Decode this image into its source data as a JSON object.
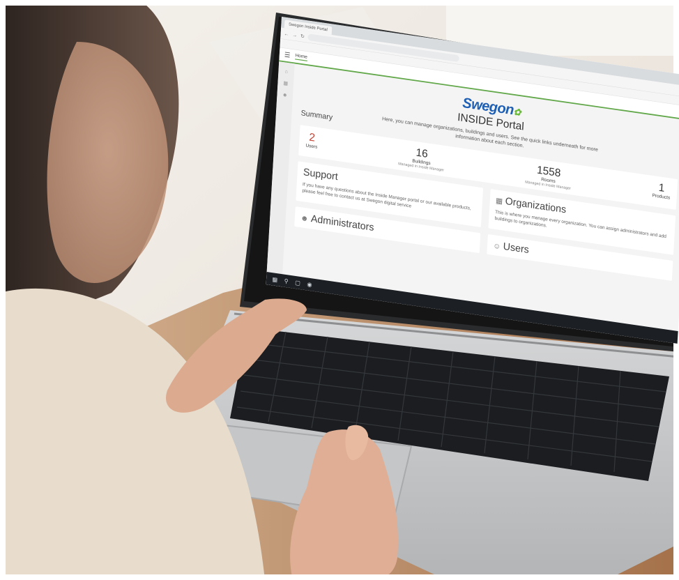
{
  "scene": {
    "colors": {
      "background": "#efe9e2",
      "table": "#b88356",
      "laptop_body": "#c9cacb",
      "laptop_bezel": "#151515",
      "keyboard": "#1b1d20",
      "hand": "#e2b49b",
      "sweater": "#e9dccd",
      "brand_blue": "#1f5fb3",
      "brand_green": "#62a84a",
      "accent_red": "#c2483a"
    }
  },
  "browser": {
    "tab_title": "Swegon Inside Portal",
    "home_tab": "Home"
  },
  "portal": {
    "logo": "Swegon",
    "title": "INSIDE Portal",
    "intro": "Here, you can manage organizations, buildings and users. See the quick links underneath for more information about each section.",
    "summary_title": "Summary",
    "stats": [
      {
        "value": "2",
        "label": "Users"
      },
      {
        "value": "16",
        "label": "Buildings",
        "sub": "Managed in Inside Manager"
      },
      {
        "value": "1558",
        "label": "Rooms",
        "sub": "Managed in Inside Manager"
      },
      {
        "value": "1",
        "label": "Products"
      }
    ],
    "support": {
      "heading": "Support",
      "text": "If you have any questions about the Inside Manager portal or our available products, please feel free to contact us at Swegon digital service"
    },
    "organizations": {
      "heading": "Organizations",
      "text": "This is where you manage every organization. You can assign administrators and add buildings to organizations."
    },
    "administrators": {
      "heading": "Administrators"
    },
    "users": {
      "heading": "Users"
    }
  }
}
